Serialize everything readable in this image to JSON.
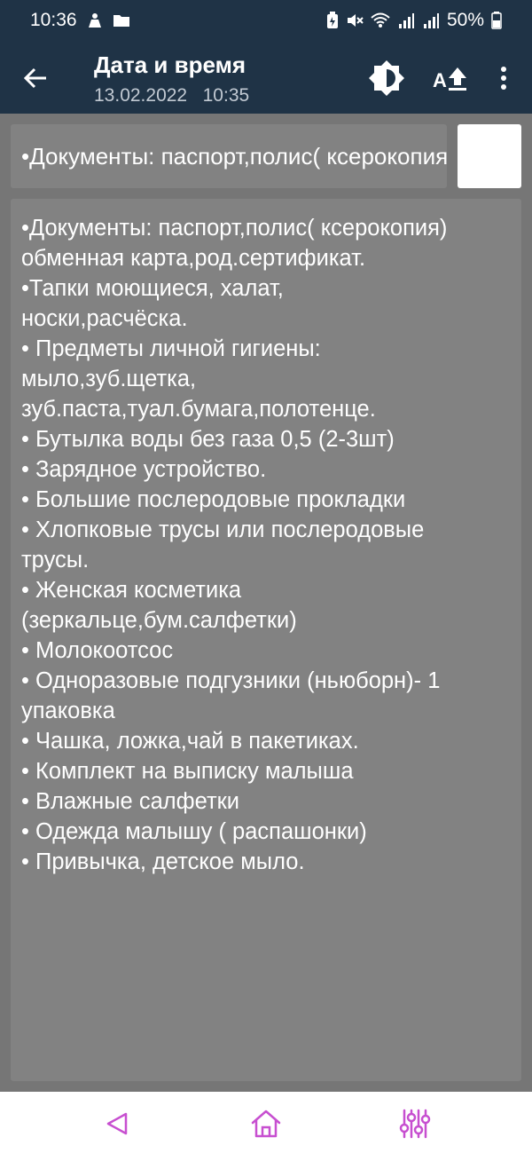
{
  "status_bar": {
    "time": "10:36",
    "battery": "50%",
    "icons": [
      "person-icon",
      "folder-icon",
      "battery-saver-icon",
      "mute-icon",
      "wifi-icon",
      "signal-r-icon",
      "signal-icon",
      "battery-icon"
    ]
  },
  "app_bar": {
    "title": "Дата и время",
    "date": "13.02.2022",
    "time": "10:35",
    "icons": [
      "back-arrow-icon",
      "brightness-icon",
      "font-size-icon",
      "more-vert-icon"
    ]
  },
  "note": {
    "title_value": "•Документы: паспорт,полис( ксерокопия)",
    "color": "#ffffff",
    "body_lines": [
      "•Документы: паспорт,полис( ксерокопия)",
      "обменная карта,род.сертификат.",
      "•Тапки моющиеся, халат,",
      "носки,расчёска.",
      "• Предметы личной гигиены:",
      "мыло,зуб.щетка,",
      "зуб.паста,туал.бумага,полотенце.",
      "• Бутылка воды без газа 0,5 (2-3шт)",
      "• Зарядное устройство.",
      "• Большие послеродовые прокладки",
      "• Хлопковые трусы или послеродовые",
      "трусы.",
      "• Женская косметика",
      "(зеркальце,бум.салфетки)",
      "• Молокоотсос",
      "• Одноразовые подгузники (ньюборн)- 1",
      "упаковка",
      "• Чашка, ложка,чай в пакетиках.",
      "• Комплект на выписку малыша",
      "• Влажные салфетки",
      "• Одежда малышу ( распашонки)",
      "• Привычка, детское мыло."
    ]
  },
  "nav_bar": {
    "accent": "#c74fd0",
    "icons": [
      "nav-back-icon",
      "nav-home-icon",
      "nav-recents-icon"
    ]
  }
}
